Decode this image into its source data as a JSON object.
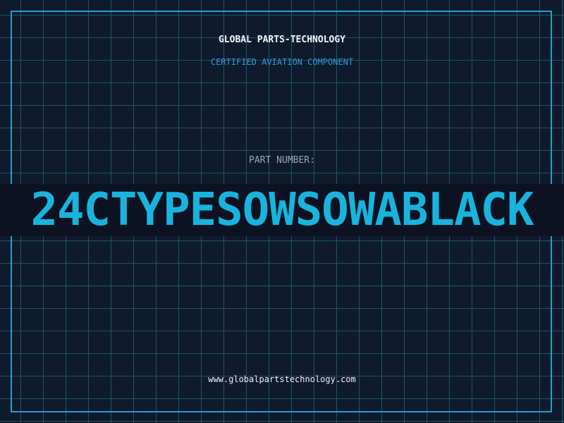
{
  "header": {
    "company": "GLOBAL PARTS-TECHNOLOGY",
    "subtitle": "CERTIFIED AVIATION COMPONENT"
  },
  "part": {
    "label": "PART NUMBER:",
    "number": "24CTYPESOWSOWABLACK"
  },
  "footer": {
    "url": "www.globalpartstechnology.com"
  },
  "colors": {
    "background": "#101a2d",
    "grid": "#1f5468",
    "accent": "#18b4dd",
    "frame": "#21a3cc"
  }
}
